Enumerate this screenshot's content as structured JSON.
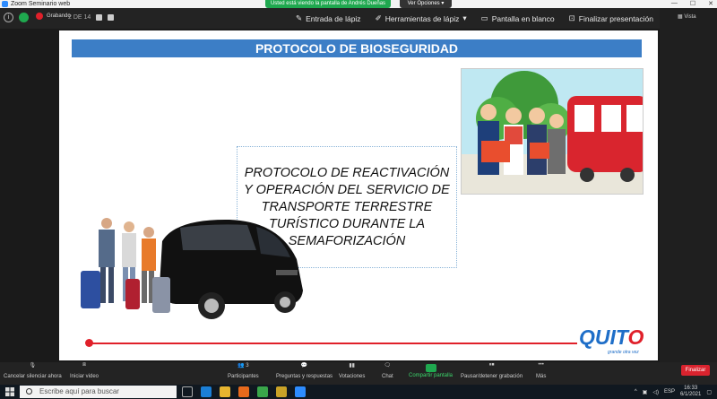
{
  "window": {
    "title": "Zoom Seminario web",
    "share_banner": "Usted está viendo la pantalla de Andrés Dueñas",
    "view_options": "Ver Opciones"
  },
  "top_bar": {
    "recording_label": "Grabando",
    "page_indicator": "2 DE 14",
    "tools": [
      {
        "label": "Entrada de lápiz",
        "icon": "pen-icon"
      },
      {
        "label": "Herramientas de lápiz",
        "icon": "pen-tools-icon"
      },
      {
        "label": "Pantalla en blanco",
        "icon": "blank-screen-icon"
      },
      {
        "label": "Finalizar presentación",
        "icon": "end-presentation-icon"
      }
    ],
    "right_label": "Vista"
  },
  "slide": {
    "header": "PROTOCOLO DE BIOSEGURIDAD",
    "body_text": "PROTOCOLO DE REACTIVACIÓN Y OPERACIÓN DEL SERVICIO DE TRANSPORTE TERRESTRE TURÍSTICO DURANTE LA SEMAFORIZACIÓN",
    "logo_main": "QUIT",
    "logo_o": "O",
    "logo_sub": "grande otra vez"
  },
  "controls": {
    "items": [
      {
        "label": "Cancelar silenciar ahora",
        "icon": "mic-muted-icon"
      },
      {
        "label": "Iniciar video",
        "icon": "video-off-icon"
      },
      {
        "label": "Participantes",
        "icon": "participants-icon",
        "count": "3"
      },
      {
        "label": "Preguntas y respuestas",
        "icon": "qa-icon"
      },
      {
        "label": "Votaciones",
        "icon": "polls-icon"
      },
      {
        "label": "Chat",
        "icon": "chat-icon"
      },
      {
        "label": "Compartir pantalla",
        "icon": "share-screen-icon"
      },
      {
        "label": "Pausar/detener grabación",
        "icon": "pause-record-icon"
      },
      {
        "label": "Más",
        "icon": "more-icon"
      }
    ],
    "end_button": "Finalizar"
  },
  "taskbar": {
    "search_placeholder": "Escribe aquí para buscar",
    "language": "ESP",
    "time": "16:33",
    "date": "6/1/2021"
  },
  "colors": {
    "header_band": "#3c7ec6",
    "share_green": "#1fa84f",
    "accent_red": "#e0202a",
    "logo_blue": "#1e6ec8"
  }
}
